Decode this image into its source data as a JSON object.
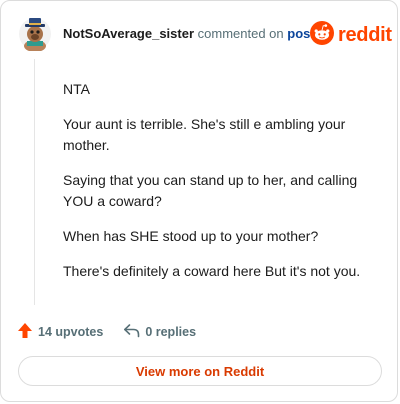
{
  "comment": {
    "username": "NotSoAverage_sister",
    "action_text": "commented on",
    "post_link_text": "post",
    "paragraphs": [
      "NTA",
      "Your aunt is terrible. She's still e ambling your mother.",
      "Saying that you can stand up to her, and calling YOU a coward?",
      "When has SHE stood up to your mother?",
      "There's definitely a coward here But it's not you."
    ]
  },
  "brand": {
    "wordmark": "reddit",
    "icon": "reddit-snoo-icon",
    "color": "#ff4500"
  },
  "stats": {
    "upvotes_label": "14 upvotes",
    "replies_label": "0 replies",
    "upvote_icon": "upvote-arrow-icon",
    "reply_icon": "reply-arrow-icon",
    "upvote_color": "#ff4500"
  },
  "footer": {
    "view_more_label": "View more on Reddit",
    "link_color": "#d93a00"
  }
}
